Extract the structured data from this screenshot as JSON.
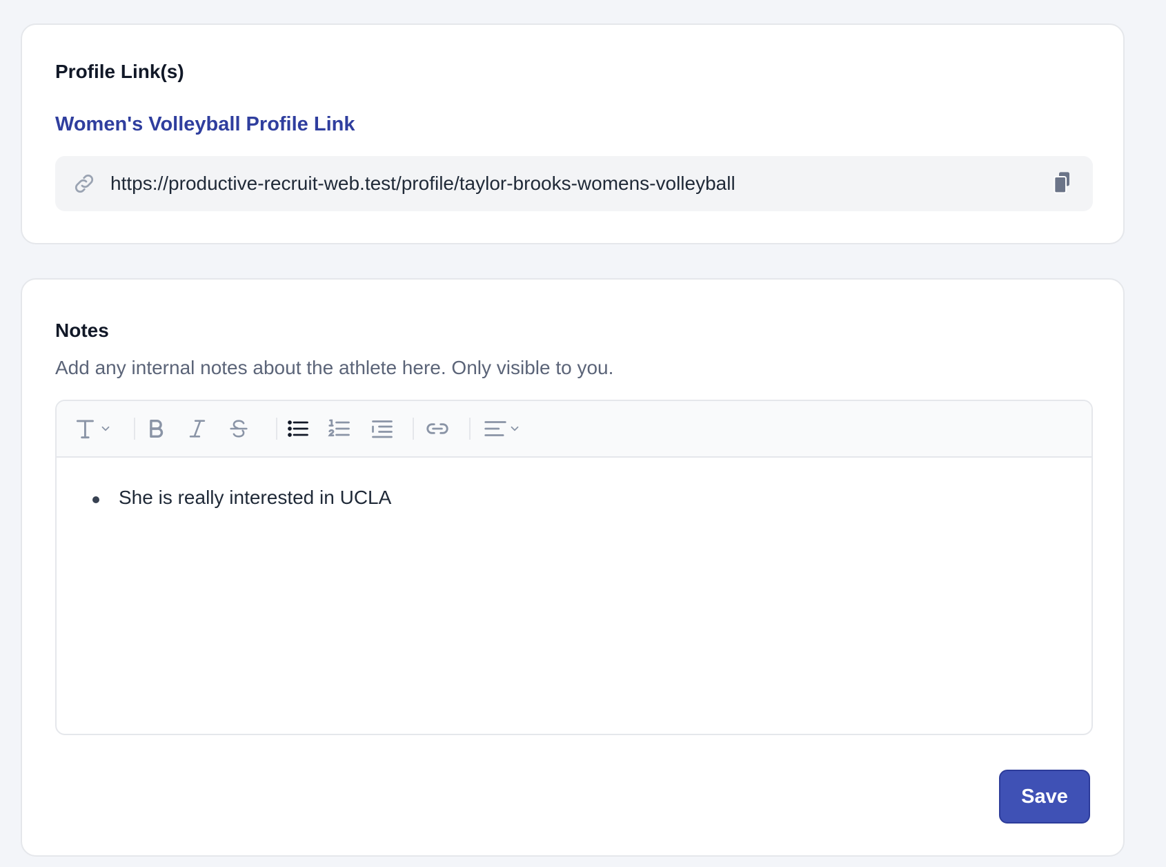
{
  "profile_section": {
    "title": "Profile Link(s)",
    "link_label": "Women's Volleyball Profile Link",
    "url": "https://productive-recruit-web.test/profile/taylor-brooks-womens-volleyball",
    "link_icon": "link-icon",
    "copy_icon": "clipboard-copy-icon"
  },
  "notes_section": {
    "title": "Notes",
    "description": "Add any internal notes about the athlete here. Only visible to you.",
    "toolbar": {
      "items": [
        {
          "name": "text-style-dropdown",
          "icon": "text-style-icon"
        },
        {
          "name": "bold-button",
          "icon": "bold-icon"
        },
        {
          "name": "italic-button",
          "icon": "italic-icon"
        },
        {
          "name": "strikethrough-button",
          "icon": "strikethrough-icon"
        },
        {
          "name": "bullet-list-button",
          "icon": "bullet-list-icon",
          "active": true
        },
        {
          "name": "ordered-list-button",
          "icon": "ordered-list-icon"
        },
        {
          "name": "indent-button",
          "icon": "indent-icon"
        },
        {
          "name": "link-button",
          "icon": "link-icon"
        },
        {
          "name": "align-dropdown",
          "icon": "align-left-icon"
        }
      ]
    },
    "content": {
      "bullets": [
        "She is really interested in UCLA"
      ]
    },
    "save_label": "Save"
  },
  "colors": {
    "background": "#f3f5f9",
    "accent": "#3f51b5",
    "link_text": "#2f3e9e",
    "icon_muted": "#8a94a6",
    "icon_active": "#111827"
  }
}
